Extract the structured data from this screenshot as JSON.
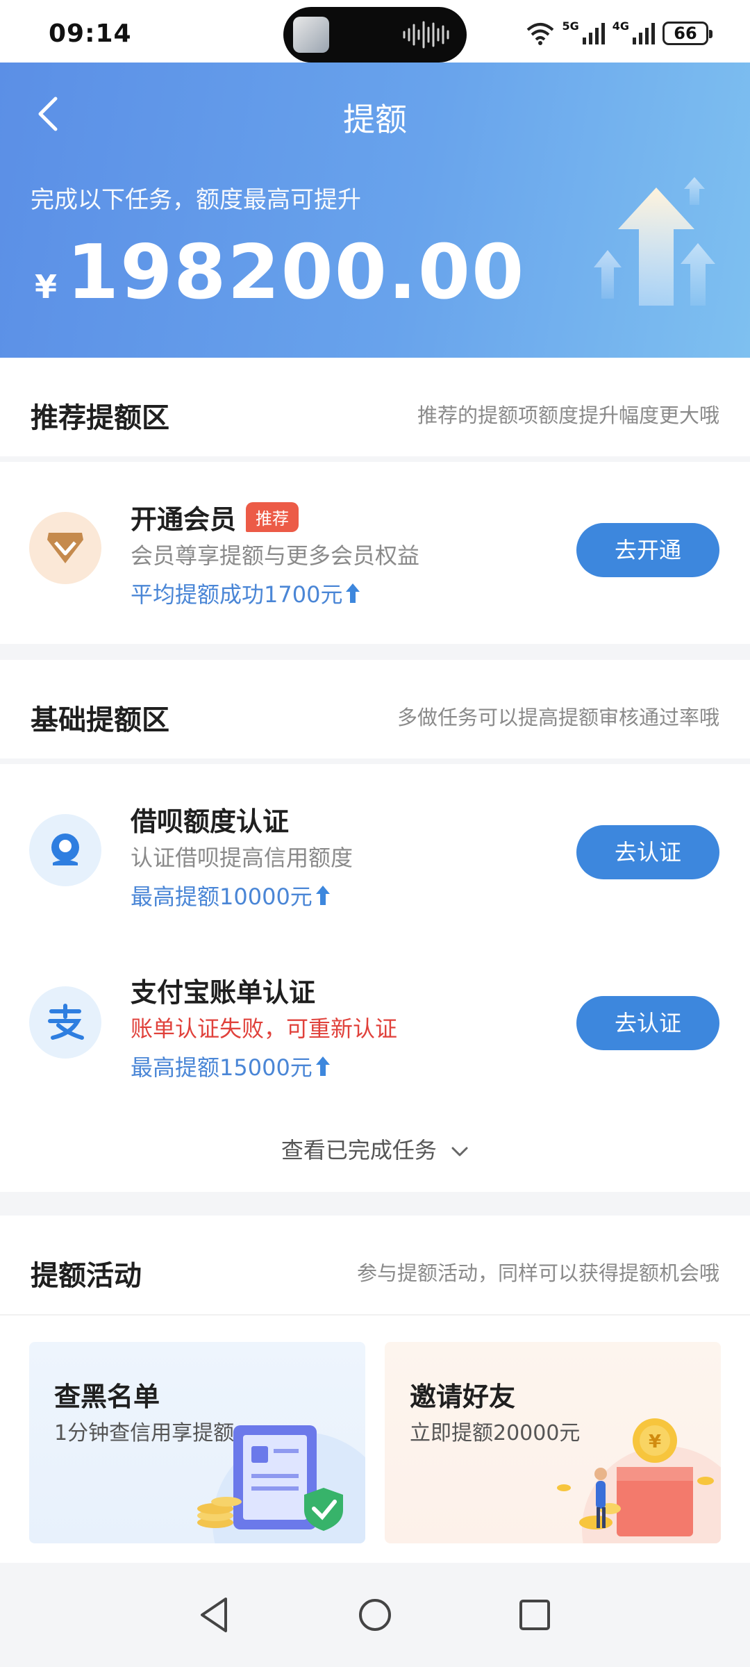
{
  "status_bar": {
    "time": "09:14",
    "signal_1": "5G",
    "signal_2": "4G",
    "battery": "66",
    "icons": [
      "wifi-icon",
      "signal-icon",
      "battery-icon"
    ]
  },
  "header": {
    "title": "提额",
    "subtitle": "完成以下任务，额度最高可提升",
    "currency": "¥",
    "amount": "198200.00"
  },
  "recommend": {
    "title": "推荐提额区",
    "note": "推荐的提额项额度提升幅度更大哦",
    "item": {
      "title": "开通会员",
      "badge": "推荐",
      "desc": "会员尊享提额与更多会员权益",
      "note": "平均提额成功1700元",
      "button": "去开通"
    }
  },
  "basic": {
    "title": "基础提额区",
    "note": "多做任务可以提高提额审核通过率哦",
    "items": [
      {
        "title": "借呗额度认证",
        "desc": "认证借呗提高信用额度",
        "note": "最高提额10000元",
        "button": "去认证"
      },
      {
        "title": "支付宝账单认证",
        "desc": "账单认证失败，可重新认证",
        "note": "最高提额15000元",
        "button": "去认证"
      }
    ],
    "view_done": "查看已完成任务"
  },
  "activities": {
    "title": "提额活动",
    "note": "参与提额活动，同样可以获得提额机会哦",
    "cards": [
      {
        "title": "查黑名单",
        "desc": "1分钟查信用享提额"
      },
      {
        "title": "邀请好友",
        "desc": "立即提额20000元"
      }
    ]
  },
  "colors": {
    "header_start": "#5b8fe6",
    "header_end": "#7ec0f0",
    "button": "#3d87dd",
    "link": "#4a86d6",
    "warning": "#e0413b",
    "badge": "#ec5b47"
  }
}
